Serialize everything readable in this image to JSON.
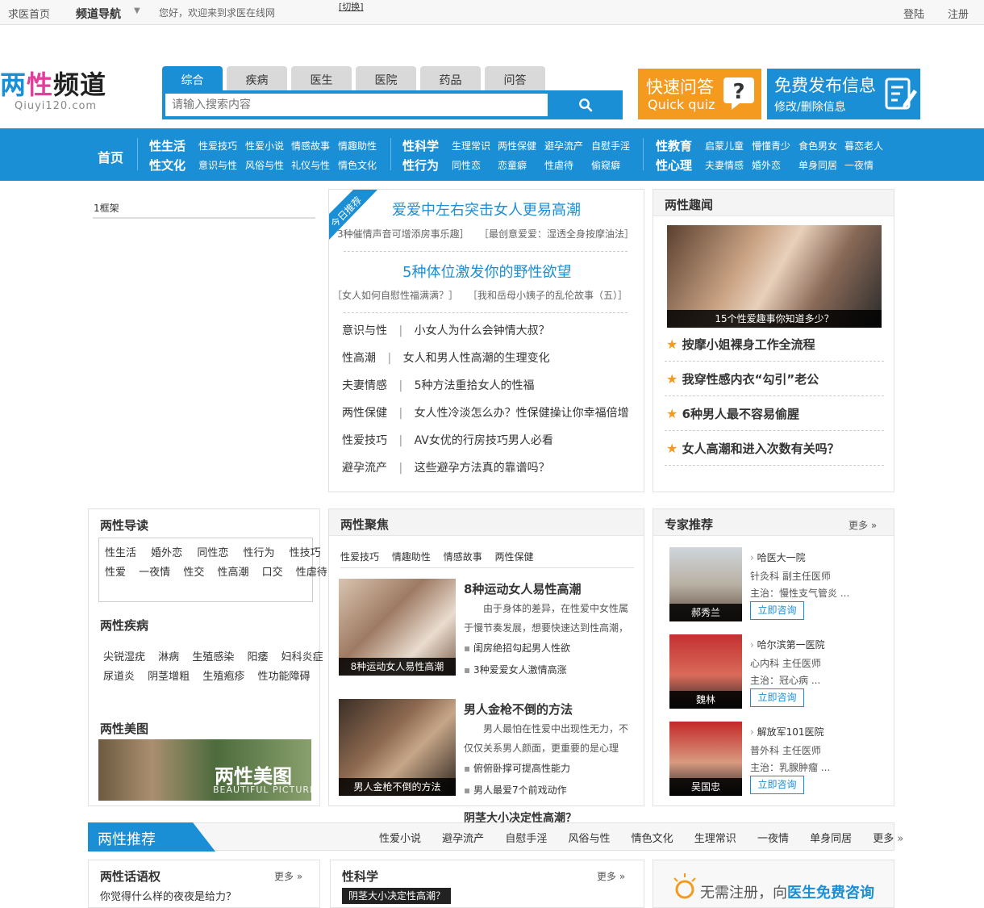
{
  "topbar": {
    "home": "求医首页",
    "channel_nav": "频道导航",
    "welcome": "您好，欢迎来到求医在线网",
    "switch": "[切换]",
    "login": "登陆",
    "register": "注册"
  },
  "logo": {
    "part1": "两",
    "part2": "性",
    "part3": "频道",
    "domain": "Qiuyi120.com"
  },
  "search": {
    "tabs": [
      "综合",
      "疾病",
      "医生",
      "医院",
      "药品",
      "问答"
    ],
    "placeholder": "请输入搜索内容"
  },
  "quick": {
    "title": "快速问答",
    "sub": "Quick quiz"
  },
  "free": {
    "title": "免费发布信息",
    "sub": "修改/删除信息"
  },
  "nav": {
    "home": "首页",
    "g1": {
      "r1": "性生活",
      "r1_items": [
        "性爱技巧",
        "性爱小说",
        "情感故事",
        "情趣助性"
      ],
      "r2": "性文化",
      "r2_items": [
        "意识与性",
        "风俗与性",
        "礼仪与性",
        "情色文化"
      ]
    },
    "g2": {
      "r1": "性科学",
      "r1_items": [
        "生理常识",
        "两性保健",
        "避孕流产",
        "自慰手淫"
      ],
      "r2": "性行为",
      "r2_items": [
        "同性恋",
        "恋童癖",
        "性虐待",
        "偷窥癖"
      ]
    },
    "g3": {
      "r1": "性教育",
      "r1_items": [
        "启蒙儿童",
        "懵懂青少",
        "食色男女",
        "暮恋老人"
      ],
      "r2": "性心理",
      "r2_items": [
        "夫妻情感",
        "婚外恋",
        "单身同居",
        "一夜情"
      ]
    }
  },
  "left_frame": "1框架",
  "featured": {
    "badge": "今日推荐",
    "headline1": "爱爱中左右突击女人更易高潮",
    "sub1a": "3种催情声音可增添房事乐趣］",
    "sub1b": "［最创意爱爱：湿透全身按摩油法］",
    "headline2": "5种体位激发你的野性欲望",
    "sub2a": "［女人如何自慰性福满满？］",
    "sub2b": "［我和岳母小姨子的乱伦故事（五）］",
    "list": [
      {
        "cat": "意识与性",
        "title": "小女人为什么会钟情大叔？"
      },
      {
        "cat": "性高潮",
        "title": "女人和男人性高潮的生理变化"
      },
      {
        "cat": "夫妻情感",
        "title": "5种方法重拾女人的性福"
      },
      {
        "cat": "两性保健",
        "title": "女人性冷淡怎么办？性保健操让你幸福倍增"
      },
      {
        "cat": "性爱技巧",
        "title": "AV女优的行房技巧男人必看"
      },
      {
        "cat": "避孕流产",
        "title": "这些避孕方法真的靠谱吗？"
      }
    ]
  },
  "fun": {
    "title": "两性趣闻",
    "caption": "15个性爱趣事你知道多少？",
    "items": [
      "按摩小姐裸身工作全流程",
      "我穿性感内衣“勾引”老公",
      "6种男人最不容易偷腥",
      "女人高潮和进入次数有关吗？"
    ]
  },
  "guide": {
    "title": "两性导读",
    "row1": [
      "性生活",
      "婚外恋",
      "同性恋",
      "性行为",
      "性技巧"
    ],
    "row2": [
      "性爱",
      "一夜情",
      "性交",
      "性高潮",
      "口交",
      "性虐待"
    ],
    "disease_title": "两性疾病",
    "d_row1": [
      "尖锐湿疣",
      "淋病",
      "生殖感染",
      "阳痿",
      "妇科炎症"
    ],
    "d_row2": [
      "尿道炎",
      "阴茎增粗",
      "生殖疱疹",
      "性功能障碍"
    ],
    "pic_title": "两性美图",
    "pic_text": "两性美图",
    "pic_sub": "BEAUTIFUL PICTURES"
  },
  "focus": {
    "title": "两性聚焦",
    "tabs": [
      "性爱技巧",
      "情趣助性",
      "情感故事",
      "两性保健"
    ],
    "a1": {
      "cap": "8种运动女人易性高潮",
      "title": "8种运动女人易性高潮",
      "l1": "由于身体的差异，在性爱中女性属",
      "l2": "于慢节奏发展，想要快速达到性高潮，",
      "b1": "闺房绝招勾起男人性欲",
      "b2": "3种爱爱女人激情高涨"
    },
    "a2": {
      "cap": "男人金枪不倒的方法",
      "title": "男人金枪不倒的方法",
      "l1": "男人最怕在性爱中出现性无力，不",
      "l2": "仅仅关系男人颜面，更重要的是心理",
      "b1": "俯俯卧撑可提高性能力",
      "b2": "男人最爱7个前戏动作"
    },
    "overflow": "阴茎大小决定性高潮？"
  },
  "experts": {
    "title": "专家推荐",
    "more": "更多",
    "consult": "立即咨询",
    "list": [
      {
        "name": "郝秀兰",
        "hospital": "哈医大一院",
        "dept": "针灸科  副主任医师",
        "main": "主治：慢性支气管炎 ..."
      },
      {
        "name": "魏林",
        "hospital": "哈尔滨第一医院",
        "dept": "心内科  主任医师",
        "main": "主治：冠心病 ..."
      },
      {
        "name": "吴国忠",
        "hospital": "解放军101医院",
        "dept": "普外科  主任医师",
        "main": "主治：乳腺肿瘤 ..."
      }
    ]
  },
  "recommend": {
    "title": "两性推荐",
    "links": [
      "性爱小说",
      "避孕流产",
      "自慰手淫",
      "风俗与性",
      "情色文化",
      "生理常识",
      "一夜情",
      "单身同居",
      "更多"
    ]
  },
  "bottom": {
    "talk_title": "两性话语权",
    "more": "更多",
    "talk_line": "你觉得什么样的夜夜是给力？",
    "science_title": "性科学",
    "science_line": "阴茎大小决定性高潮？",
    "banner_a": "无需注册，向",
    "banner_b": "医生免费咨询"
  },
  "colors": {
    "brand": "#1a8fd6",
    "orange": "#f39a1f",
    "pink": "#e0409a"
  }
}
